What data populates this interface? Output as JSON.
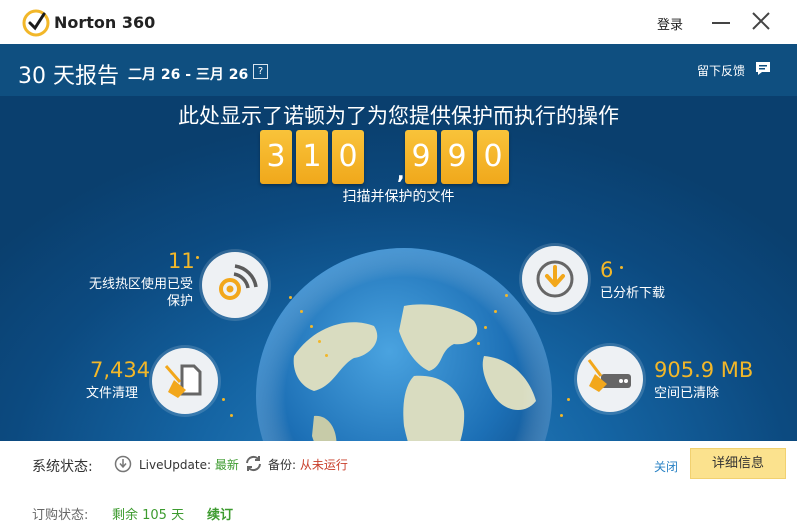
{
  "app": {
    "title": "Norton 360",
    "login_label": "登录"
  },
  "header": {
    "report_title": "30 天报告",
    "date_range": "二月 26 - 三月 26",
    "help_glyph": "?",
    "feedback_label": "留下反馈"
  },
  "hero": {
    "heading": "此处显示了诺顿为了为您提供保护而执行的操作",
    "counter_digits": [
      "3",
      "1",
      "0",
      "9",
      "9",
      "0"
    ],
    "counter_separator": ",",
    "counter_caption": "扫描并保护的文件"
  },
  "stats": {
    "wifi": {
      "value": "11",
      "label_line1": "无线热区使用已受",
      "label_line2": "保护",
      "icon": "wifi-signal-icon"
    },
    "cleanup": {
      "value": "7,434",
      "label": "文件清理",
      "icon": "broom-file-icon"
    },
    "downloads": {
      "value": "6",
      "label": "已分析下载",
      "icon": "download-arrow-icon"
    },
    "space": {
      "value": "905.9 MB",
      "label": "空间已清除",
      "icon": "broom-disk-icon"
    }
  },
  "status": {
    "system_label": "系统状态:",
    "liveupdate_label": "LiveUpdate:",
    "liveupdate_status": "最新",
    "backup_label": "备份:",
    "backup_status": "从未运行",
    "close_label": "关闭",
    "details_label": "详细信息",
    "subscription_label": "订购状态:",
    "subscription_days": "剩余 105 天",
    "renew_label": "续订"
  },
  "colors": {
    "header_blue": "#0f4f80",
    "accent_gold": "#f2b729",
    "ok_green": "#3d9b2f",
    "warn_red": "#c9402c",
    "link_blue": "#2b83c5"
  }
}
